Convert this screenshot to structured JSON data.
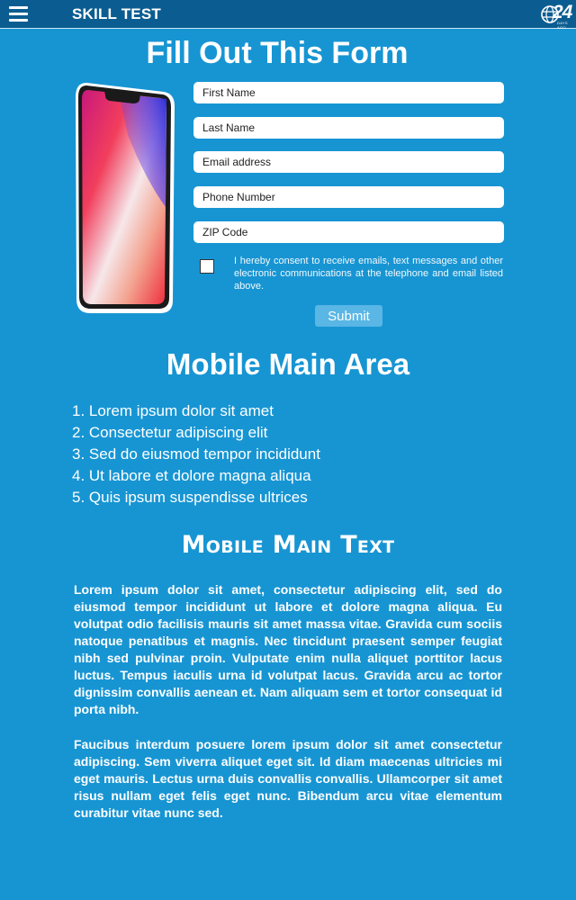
{
  "header": {
    "title": "SKILL TEST",
    "logo_text": "24",
    "logo_subtext": "DAYS AGO",
    "menu_icon": "hamburger-menu-icon"
  },
  "form": {
    "title": "Fill Out This Form",
    "first_name_placeholder": "First Name",
    "last_name_placeholder": "Last Name",
    "email_placeholder": "Email address",
    "phone_placeholder": "Phone Number",
    "zip_placeholder": "ZIP Code",
    "consent_text": "I hereby consent to receive emails, text messages and other electronic communications at the telephone and email listed above.",
    "consent_checked": false,
    "submit_label": "Submit"
  },
  "main_area": {
    "title": "Mobile Main Area",
    "items": [
      "1. Lorem ipsum dolor sit amet",
      "2. Consectetur adipiscing elit",
      "3. Sed do eiusmod tempor incididunt",
      "4. Ut labore et dolore magna aliqua",
      "5. Quis ipsum suspendisse ultrices"
    ]
  },
  "main_text": {
    "title": "Mobile Main Text",
    "paragraph1": "Lorem ipsum dolor sit amet, consectetur adipiscing elit, sed do eiusmod tempor incididunt ut labore et dolore magna aliqua. Eu volutpat odio facilisis mauris sit amet massa vitae. Gravida cum sociis natoque penatibus et magnis. Nec tincidunt praesent semper feugiat nibh sed pulvinar proin. Vulputate enim nulla aliquet porttitor lacus luctus. Tempus iaculis urna id volutpat lacus. Gravida arcu ac tortor dignissim convallis aenean et. Nam aliquam sem et tortor consequat id porta nibh.",
    "paragraph2": "Faucibus interdum posuere lorem ipsum dolor sit amet consectetur adipiscing. Sem viverra aliquet eget sit. Id diam maecenas ultricies mi eget mauris. Lectus urna duis convallis convallis. Ullamcorper sit amet risus nullam eget felis eget nunc. Bibendum arcu vitae elementum curabitur vitae nunc sed."
  },
  "colors": {
    "background": "#1795d3",
    "header_bar": "#0b5d91",
    "submit_button": "#59b6e5",
    "text": "#ffffff"
  }
}
